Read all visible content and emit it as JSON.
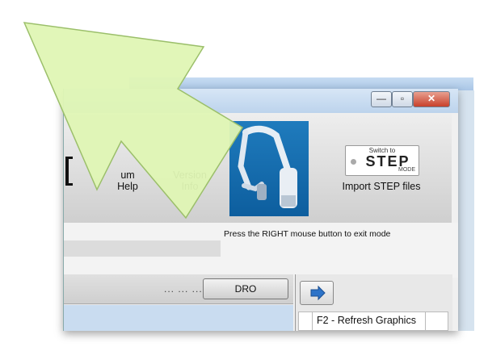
{
  "window": {
    "controls": {
      "minimize": "—",
      "maximize": "▫",
      "close": "✕"
    }
  },
  "ribbon": {
    "partial_help_label_line1": "um",
    "partial_help_label_line2": "Help",
    "version_label_line1": "Version",
    "version_label_line2": "Info",
    "step_logo_top": "Switch to",
    "step_logo_main": "STEP",
    "step_logo_bottom": "MODE",
    "import_step_label": "Import STEP files"
  },
  "status": {
    "message": "Press the RIGHT mouse button to exit mode"
  },
  "toolbar": {
    "dots": "... ... ...",
    "dro_label": "DRO"
  },
  "right_panel": {
    "f2_label": "F2 - Refresh Graphics"
  },
  "colors": {
    "overlay_arrow_fill": "#dff5b4",
    "overlay_arrow_stroke": "#9bbf6a",
    "arm_tile_blue": "#1f7bbd",
    "blue_area": "#c9dcf0"
  },
  "icons": {
    "arm_tile": "measuring-arm-icon",
    "arrow_button": "blue-right-arrow-icon",
    "overlay": "green-pointer-arrow-icon"
  }
}
